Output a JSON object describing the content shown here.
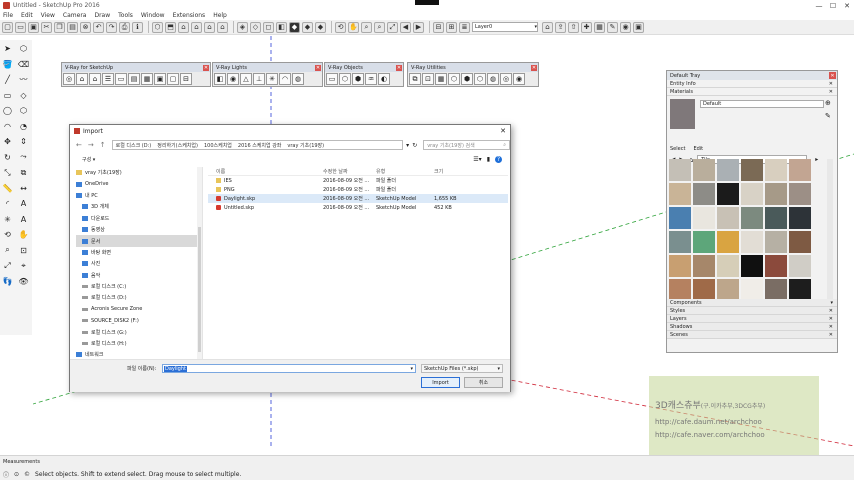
{
  "window": {
    "title": "Untitled - SketchUp Pro 2016",
    "controls": [
      "—",
      "☐",
      "✕"
    ]
  },
  "menu": [
    "File",
    "Edit",
    "View",
    "Camera",
    "Draw",
    "Tools",
    "Window",
    "Extensions",
    "Help"
  ],
  "toolbar": {
    "layer_value": "Layer0"
  },
  "floating_toolbars": [
    {
      "title": "V-Ray for SketchUp"
    },
    {
      "title": "V-Ray Lights"
    },
    {
      "title": "V-Ray Objects"
    },
    {
      "title": "V-Ray Utilities"
    }
  ],
  "dialog": {
    "title": "Import",
    "close": "✕",
    "breadcrumbs": [
      "로컬 디스크 (D:)",
      "정리하기(스케치업)",
      "100스케치업",
      "2016 스케치업 강좌",
      "vray 기초(19장)"
    ],
    "search_placeholder": "vray 기초(19장) 검색",
    "organize": "구성 ▾",
    "nav_pane": [
      {
        "label": "vray 기초(19장)",
        "icon": "folder"
      },
      {
        "label": "OneDrive",
        "icon": "blue"
      },
      {
        "label": "내 PC",
        "icon": "blue"
      },
      {
        "label": "3D 개체",
        "icon": "blue"
      },
      {
        "label": "다운로드",
        "icon": "blue"
      },
      {
        "label": "동영상",
        "icon": "blue"
      },
      {
        "label": "문서",
        "icon": "blue",
        "selected": true
      },
      {
        "label": "바탕 화면",
        "icon": "blue"
      },
      {
        "label": "사진",
        "icon": "blue"
      },
      {
        "label": "음악",
        "icon": "blue"
      },
      {
        "label": "로컬 디스크 (C:)",
        "icon": "drive"
      },
      {
        "label": "로컬 디스크 (D:)",
        "icon": "drive"
      },
      {
        "label": "Acronis Secure Zone",
        "icon": "drive"
      },
      {
        "label": "SOURCE_DISK2 (F:)",
        "icon": "drive"
      },
      {
        "label": "로컬 디스크 (G:)",
        "icon": "drive"
      },
      {
        "label": "로컬 디스크 (H:)",
        "icon": "drive"
      },
      {
        "label": "네트워크",
        "icon": "blue"
      }
    ],
    "columns": [
      "이름",
      "수정한 날짜",
      "유형",
      "크기"
    ],
    "files": [
      {
        "name": "IES",
        "date": "2016-08-09 오전 ...",
        "type": "파일 폴더",
        "size": "",
        "icon": "folder"
      },
      {
        "name": "PNG",
        "date": "2016-08-09 오전 ...",
        "type": "파일 폴더",
        "size": "",
        "icon": "folder"
      },
      {
        "name": "Daylight.skp",
        "date": "2016-08-09 오전 ...",
        "type": "SketchUp Model",
        "size": "1,655 KB",
        "icon": "skp"
      },
      {
        "name": "Untitled.skp",
        "date": "2016-08-09 오전 ...",
        "type": "SketchUp Model",
        "size": "452 KB",
        "icon": "skp"
      }
    ],
    "filename_label": "파일 이름(N):",
    "filename_value": "Daylight",
    "filetype": "SketchUp Files (*.skp)",
    "import_button": "Import",
    "cancel_button": "취소"
  },
  "tray": {
    "title": "Default Tray",
    "sections_top": [
      "Entity Info",
      "Materials"
    ],
    "material_name": "Default",
    "material_tabs": [
      "Select",
      "Edit"
    ],
    "material_category": "Tile",
    "sections_bottom": [
      "Components",
      "Styles",
      "Layers",
      "Shadows",
      "Scenes"
    ],
    "swatches": [
      "#c4bfb6",
      "#b9ae9c",
      "#aab0b4",
      "#7b6a55",
      "#d8cfbf",
      "#c2a592",
      "#c9b497",
      "#8d8c87",
      "#1b1b1b",
      "#d8d2c6",
      "#a69a88",
      "#9c8f86",
      "#4a7fb0",
      "#e9e6df",
      "#c8c1b5",
      "#7c8a7f",
      "#4a5a5a",
      "#2d3338",
      "#7a8f8f",
      "#5da67a",
      "#d9a441",
      "#e2ddd5",
      "#b6b0a4",
      "#7e5a43",
      "#c89f71",
      "#a6876a",
      "#d6ceb8",
      "#101010",
      "#8b4a3c",
      "#d0cdc6",
      "#b58160",
      "#9f6a48",
      "#bda68b",
      "#f0ede8",
      "#7a6d64",
      "#1d1d1d"
    ]
  },
  "watermark": {
    "title": "3D캐스츄부",
    "subtitle": "(구.이카추부,3DCG추부)",
    "url1": "http://cafe.daum.net/archchoo",
    "url2": "http://cafe.naver.com/archchoo"
  },
  "status": {
    "tab": "Measurements",
    "message": "Select objects. Shift to extend select. Drag mouse to select multiple."
  },
  "colors": {
    "accent": "#2b6fd6",
    "axis_green": "#2fa33a",
    "axis_red": "#d0293a",
    "axis_blue": "#2b3fd6"
  }
}
